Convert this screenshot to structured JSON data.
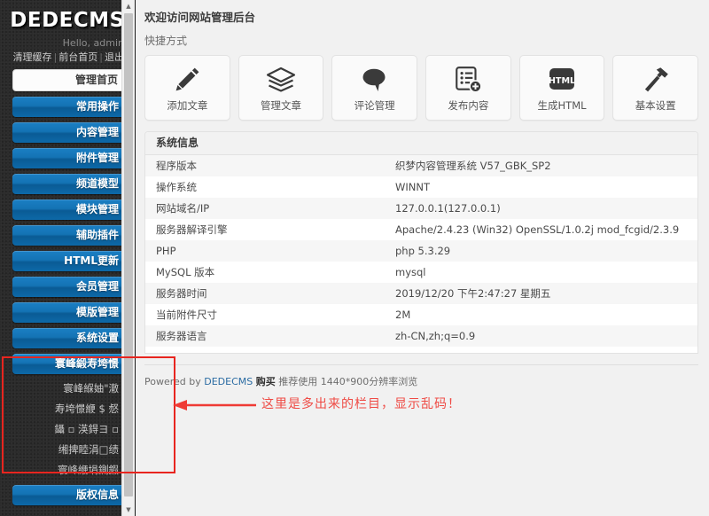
{
  "sidebar": {
    "brand": "DEDECMS",
    "hello": "Hello, admin",
    "links": [
      {
        "label": "清理缓存"
      },
      {
        "label": "前台首页"
      },
      {
        "label": "退出"
      }
    ],
    "link_separator": "|",
    "home_button": "管理首页",
    "menu": [
      {
        "label": "常用操作"
      },
      {
        "label": "内容管理"
      },
      {
        "label": "附件管理"
      },
      {
        "label": "频道模型"
      },
      {
        "label": "模块管理"
      },
      {
        "label": "辅助插件"
      },
      {
        "label": "HTML更新"
      },
      {
        "label": "会员管理"
      },
      {
        "label": "模版管理"
      },
      {
        "label": "系统设置"
      }
    ],
    "garbled_group": {
      "header": "寰峰緞寿垮憬",
      "items": [
        "寰峰緥妯\"澈",
        "寿垮憬緶 $ 惄",
        "鑷 ▫ 渶鍀ヨ ▫",
        "缃捭睦涓□绩",
        "寰峰緶埍鍘鍜"
      ]
    },
    "bottom_menu": {
      "label": "版权信息"
    },
    "scrollbar": {
      "up_arrow": "▲",
      "down_arrow": "▼"
    }
  },
  "main": {
    "title": "欢迎访问网站管理后台",
    "subtitle": "快捷方式",
    "shortcuts": [
      {
        "label": "添加文章",
        "icon": "pencil-icon"
      },
      {
        "label": "管理文章",
        "icon": "stack-icon"
      },
      {
        "label": "评论管理",
        "icon": "comment-bubble-icon"
      },
      {
        "label": "发布内容",
        "icon": "list-add-icon"
      },
      {
        "label": "生成HTML",
        "icon": "html-badge-icon",
        "icon_text": "HTML"
      },
      {
        "label": "基本设置",
        "icon": "hammer-icon"
      }
    ],
    "sysinfo": {
      "panel_title": "系统信息",
      "rows": [
        {
          "key": "程序版本",
          "value": "织梦内容管理系统 V57_GBK_SP2"
        },
        {
          "key": "操作系统",
          "value": "WINNT"
        },
        {
          "key": "网站域名/IP",
          "value": "127.0.0.1(127.0.0.1)"
        },
        {
          "key": "服务器解译引擎",
          "value": "Apache/2.4.23 (Win32) OpenSSL/1.0.2j mod_fcgid/2.3.9"
        },
        {
          "key": "PHP",
          "value": "php 5.3.29"
        },
        {
          "key": "MySQL 版本",
          "value": "mysql"
        },
        {
          "key": "服务器时间",
          "value": "2019/12/20 下午2:47:27 星期五"
        },
        {
          "key": "当前附件尺寸",
          "value": "2M"
        },
        {
          "key": "服务器语言",
          "value": "zh-CN,zh;q=0.9"
        }
      ]
    },
    "footer": {
      "powered_prefix": "Powered by",
      "brand_link": "DEDECMS",
      "buy_link": "购买",
      "recommend": "推荐使用 1440*900分辨率浏览"
    }
  },
  "annotation": {
    "text": "这里是多出来的栏目，显示乱码！",
    "color": "#ef4b45"
  }
}
